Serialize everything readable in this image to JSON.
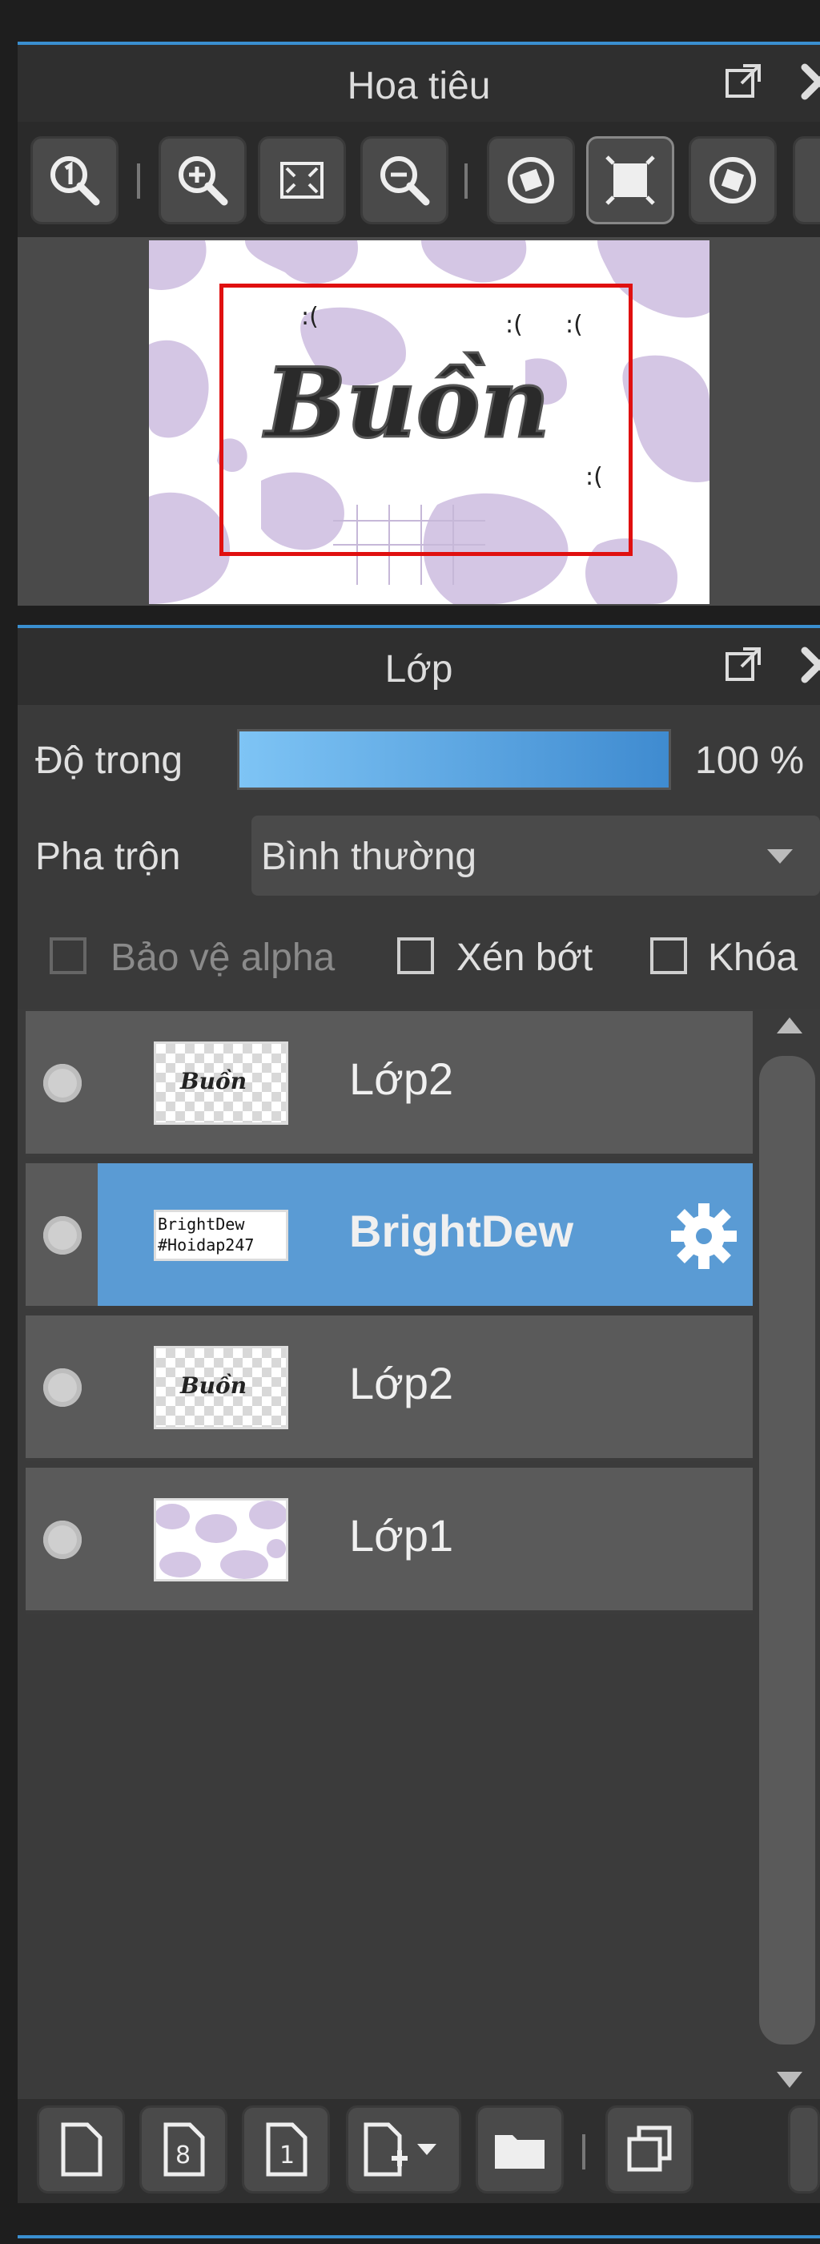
{
  "navigator": {
    "title": "Hoa tiêu",
    "toolbar": [
      {
        "icon": "zoom-actual-icon"
      },
      {
        "icon": "zoom-in-icon"
      },
      {
        "icon": "fit-screen-icon"
      },
      {
        "icon": "zoom-out-icon"
      },
      {
        "icon": "rotate-left-icon"
      },
      {
        "icon": "reset-rotation-icon"
      },
      {
        "icon": "rotate-right-icon"
      }
    ],
    "preview": {
      "artwork_text": "Buồn",
      "faces": [
        ":(",
        ":(",
        ":(",
        ":("
      ]
    }
  },
  "layers": {
    "title": "Lớp",
    "opacity_label": "Độ trong",
    "opacity_value": "100 %",
    "opacity_fraction": 1.0,
    "blend_label": "Pha trộn",
    "blend_value": "Bình thường",
    "options": {
      "protect_alpha": "Bảo vệ alpha",
      "clipping": "Xén bớt",
      "lock": "Khóa"
    },
    "items": [
      {
        "name": "Lớp2",
        "thumb_text": "Buồn",
        "selected": false
      },
      {
        "name": "BrightDew",
        "thumb_text": "BrightDew #Hoidap247",
        "selected": true
      },
      {
        "name": "Lớp2",
        "thumb_text": "Buồn",
        "selected": false
      },
      {
        "name": "Lớp1",
        "thumb_text": "",
        "selected": false
      }
    ]
  },
  "colors": {
    "accent": "#5a9bd4",
    "panel": "#2f2f2f",
    "background": "#1e1e1e",
    "red_frame": "#e01010",
    "lilac": "#d4c6e4"
  }
}
